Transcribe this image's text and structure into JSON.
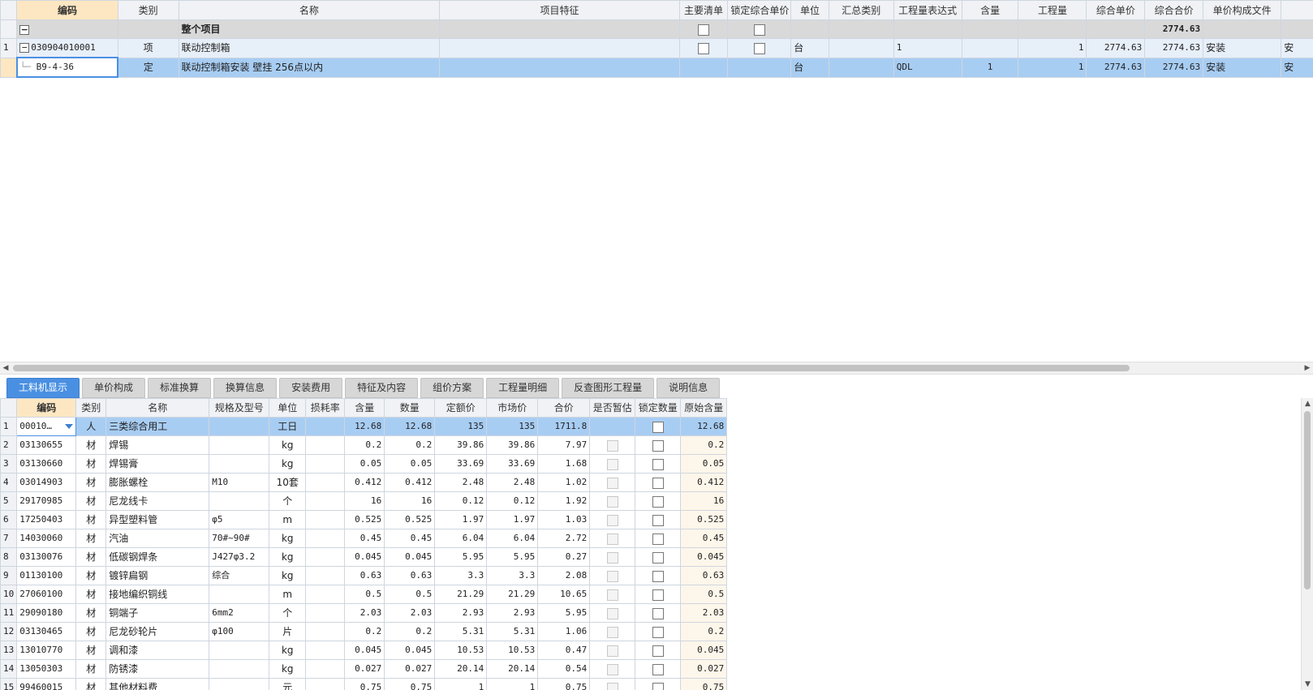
{
  "top_grid": {
    "columns": [
      "编码",
      "类别",
      "名称",
      "项目特征",
      "主要清单",
      "锁定综合单价",
      "单位",
      "汇总类别",
      "工程量表达式",
      "含量",
      "工程量",
      "综合单价",
      "综合合价",
      "单价构成文件"
    ],
    "summary": {
      "name": "整个项目",
      "total": "2774.63"
    },
    "item": {
      "row_no": "1",
      "code": "030904010001",
      "type": "项",
      "name": "联动控制箱",
      "unit": "台",
      "expr": "1",
      "qty": "1",
      "unit_price": "2774.63",
      "total": "2774.63",
      "file": "安装",
      "overflow": "安"
    },
    "sub": {
      "code": "B9-4-36",
      "type": "定",
      "name": "联动控制箱安装 壁挂 256点以内",
      "unit": "台",
      "expr": "QDL",
      "content": "1",
      "qty": "1",
      "unit_price": "2774.63",
      "total": "2774.63",
      "file": "安装",
      "overflow": "安"
    }
  },
  "tabs": [
    "工料机显示",
    "单价构成",
    "标准换算",
    "换算信息",
    "安装费用",
    "特征及内容",
    "组价方案",
    "工程量明细",
    "反查图形工程量",
    "说明信息"
  ],
  "bottom_grid": {
    "columns": [
      "编码",
      "类别",
      "名称",
      "规格及型号",
      "单位",
      "损耗率",
      "含量",
      "数量",
      "定额价",
      "市场价",
      "合价",
      "是否暂估",
      "锁定数量",
      "原始含量"
    ],
    "rows": [
      {
        "n": "1",
        "code": "00010…",
        "type": "人",
        "name": "三类综合用工",
        "spec": "",
        "unit": "工日",
        "loss": "",
        "content": "12.68",
        "qty": "12.68",
        "quota": "135",
        "market": "135",
        "total": "1711.8",
        "orig": "12.68"
      },
      {
        "n": "2",
        "code": "03130655",
        "type": "材",
        "name": "焊锡",
        "spec": "",
        "unit": "kg",
        "loss": "",
        "content": "0.2",
        "qty": "0.2",
        "quota": "39.86",
        "market": "39.86",
        "total": "7.97",
        "orig": "0.2"
      },
      {
        "n": "3",
        "code": "03130660",
        "type": "材",
        "name": "焊锡膏",
        "spec": "",
        "unit": "kg",
        "loss": "",
        "content": "0.05",
        "qty": "0.05",
        "quota": "33.69",
        "market": "33.69",
        "total": "1.68",
        "orig": "0.05"
      },
      {
        "n": "4",
        "code": "03014903",
        "type": "材",
        "name": "膨胀螺栓",
        "spec": "M10",
        "unit": "10套",
        "loss": "",
        "content": "0.412",
        "qty": "0.412",
        "quota": "2.48",
        "market": "2.48",
        "total": "1.02",
        "orig": "0.412"
      },
      {
        "n": "5",
        "code": "29170985",
        "type": "材",
        "name": "尼龙线卡",
        "spec": "",
        "unit": "个",
        "loss": "",
        "content": "16",
        "qty": "16",
        "quota": "0.12",
        "market": "0.12",
        "total": "1.92",
        "orig": "16"
      },
      {
        "n": "6",
        "code": "17250403",
        "type": "材",
        "name": "异型塑料管",
        "spec": "φ5",
        "unit": "m",
        "loss": "",
        "content": "0.525",
        "qty": "0.525",
        "quota": "1.97",
        "market": "1.97",
        "total": "1.03",
        "orig": "0.525"
      },
      {
        "n": "7",
        "code": "14030060",
        "type": "材",
        "name": "汽油",
        "spec": "70#~90#",
        "unit": "kg",
        "loss": "",
        "content": "0.45",
        "qty": "0.45",
        "quota": "6.04",
        "market": "6.04",
        "total": "2.72",
        "orig": "0.45"
      },
      {
        "n": "8",
        "code": "03130076",
        "type": "材",
        "name": "低碳钢焊条",
        "spec": "J427φ3.2",
        "unit": "kg",
        "loss": "",
        "content": "0.045",
        "qty": "0.045",
        "quota": "5.95",
        "market": "5.95",
        "total": "0.27",
        "orig": "0.045"
      },
      {
        "n": "9",
        "code": "01130100",
        "type": "材",
        "name": "镀锌扁钢",
        "spec": "综合",
        "unit": "kg",
        "loss": "",
        "content": "0.63",
        "qty": "0.63",
        "quota": "3.3",
        "market": "3.3",
        "total": "2.08",
        "orig": "0.63"
      },
      {
        "n": "10",
        "code": "27060100",
        "type": "材",
        "name": "接地编织铜线",
        "spec": "",
        "unit": "m",
        "loss": "",
        "content": "0.5",
        "qty": "0.5",
        "quota": "21.29",
        "market": "21.29",
        "total": "10.65",
        "orig": "0.5"
      },
      {
        "n": "11",
        "code": "29090180",
        "type": "材",
        "name": "铜端子",
        "spec": "6mm2",
        "unit": "个",
        "loss": "",
        "content": "2.03",
        "qty": "2.03",
        "quota": "2.93",
        "market": "2.93",
        "total": "5.95",
        "orig": "2.03"
      },
      {
        "n": "12",
        "code": "03130465",
        "type": "材",
        "name": "尼龙砂轮片",
        "spec": "φ100",
        "unit": "片",
        "loss": "",
        "content": "0.2",
        "qty": "0.2",
        "quota": "5.31",
        "market": "5.31",
        "total": "1.06",
        "orig": "0.2"
      },
      {
        "n": "13",
        "code": "13010770",
        "type": "材",
        "name": "调和漆",
        "spec": "",
        "unit": "kg",
        "loss": "",
        "content": "0.045",
        "qty": "0.045",
        "quota": "10.53",
        "market": "10.53",
        "total": "0.47",
        "orig": "0.045"
      },
      {
        "n": "14",
        "code": "13050303",
        "type": "材",
        "name": "防锈漆",
        "spec": "",
        "unit": "kg",
        "loss": "",
        "content": "0.027",
        "qty": "0.027",
        "quota": "20.14",
        "market": "20.14",
        "total": "0.54",
        "orig": "0.027"
      },
      {
        "n": "15",
        "code": "99460015",
        "type": "材",
        "name": "其他材料费",
        "spec": "",
        "unit": "元",
        "loss": "",
        "content": "0.75",
        "qty": "0.75",
        "quota": "1",
        "market": "1",
        "total": "0.75",
        "orig": "0.75"
      }
    ]
  },
  "scroll": {
    "left": "◀",
    "right": "▶",
    "up": "▲",
    "down": "▼"
  }
}
